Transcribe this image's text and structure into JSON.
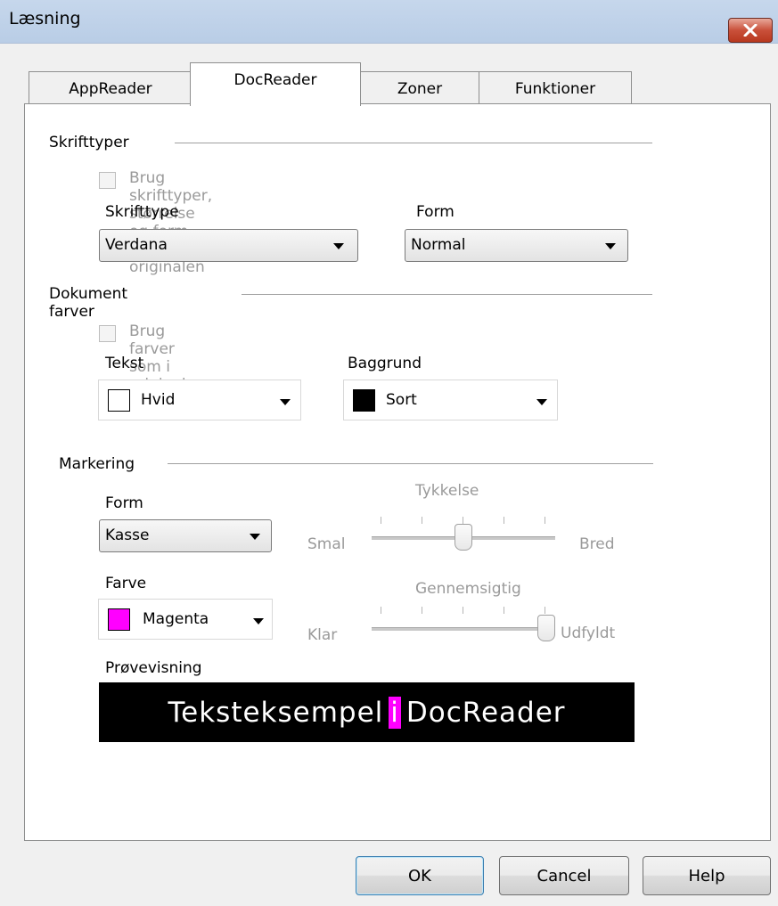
{
  "window": {
    "title": "Læsning"
  },
  "tabs": [
    {
      "label": "AppReader"
    },
    {
      "label": "DocReader"
    },
    {
      "label": "Zoner"
    },
    {
      "label": "Funktioner"
    }
  ],
  "fonts_group": {
    "title": "Skrifttyper",
    "use_original_label": "Brug skrifttyper, størrelse og form som i originalen",
    "font_label": "Skrifttype",
    "font_value": "Verdana",
    "style_label": "Form",
    "style_value": "Normal"
  },
  "colors_group": {
    "title": "Dokument farver",
    "use_original_label": "Brug farver som i originalen",
    "text_label": "Tekst",
    "text_value": "Hvid",
    "text_color": "#ffffff",
    "background_label": "Baggrund",
    "background_value": "Sort",
    "background_color": "#000000"
  },
  "highlight_group": {
    "title": "Markering",
    "form_label": "Form",
    "form_value": "Kasse",
    "color_label": "Farve",
    "color_value": "Magenta",
    "color_swatch": "#ff00ff",
    "thickness_label": "Tykkelse",
    "thickness_min_label": "Smal",
    "thickness_max_label": "Bred",
    "thickness_value": 0.5,
    "transparency_label": "Gennemsigtig",
    "transparency_min_label": "Klar",
    "transparency_max_label": "Udfyldt",
    "transparency_value": 1.0
  },
  "preview": {
    "label": "Prøvevisning",
    "text_before": "Teksteksempel",
    "highlight_text": "i",
    "text_after": "DocReader"
  },
  "buttons": {
    "ok": "OK",
    "cancel": "Cancel",
    "help": "Help"
  }
}
